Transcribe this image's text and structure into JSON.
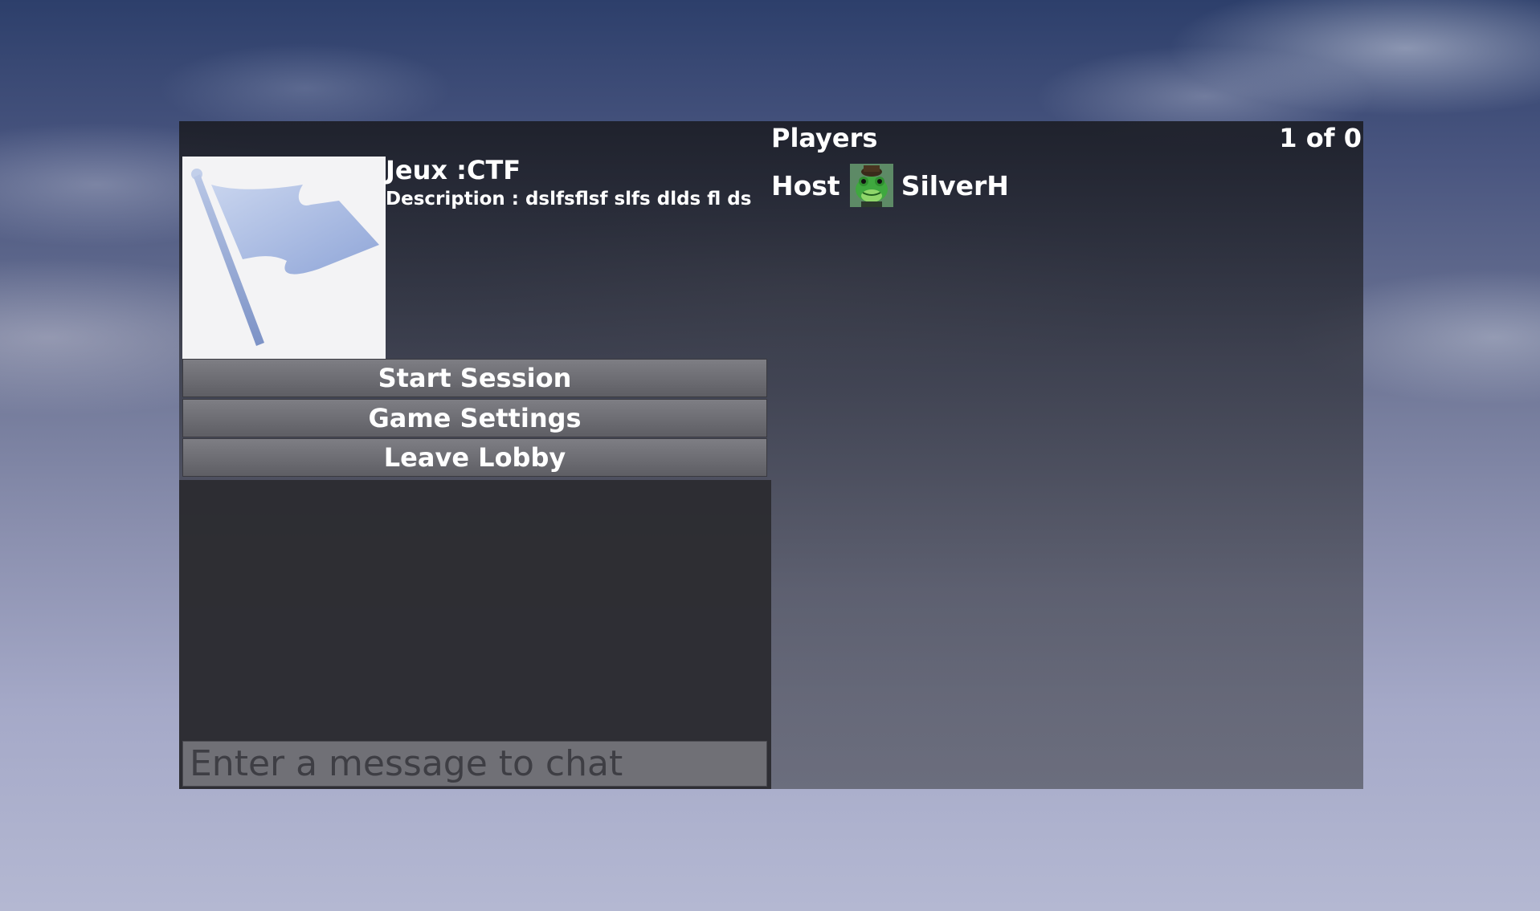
{
  "players": {
    "title": "Players",
    "count": "1 of 0",
    "list": [
      {
        "role": "Host",
        "name": "SilverH",
        "avatar": "frog-avatar-icon"
      }
    ]
  },
  "game": {
    "title": "Jeux :CTF",
    "description": "Description : dslfsflsf slfs dlds fl ds",
    "image": "flag-icon"
  },
  "menu": {
    "start": "Start Session",
    "settings": "Game Settings",
    "leave": "Leave Lobby"
  },
  "chat": {
    "placeholder": "Enter a message to chat",
    "value": ""
  },
  "colors": {
    "flag": "#a7b9e3",
    "button": "#6e6e74",
    "chat_bg": "#2c2c32"
  }
}
